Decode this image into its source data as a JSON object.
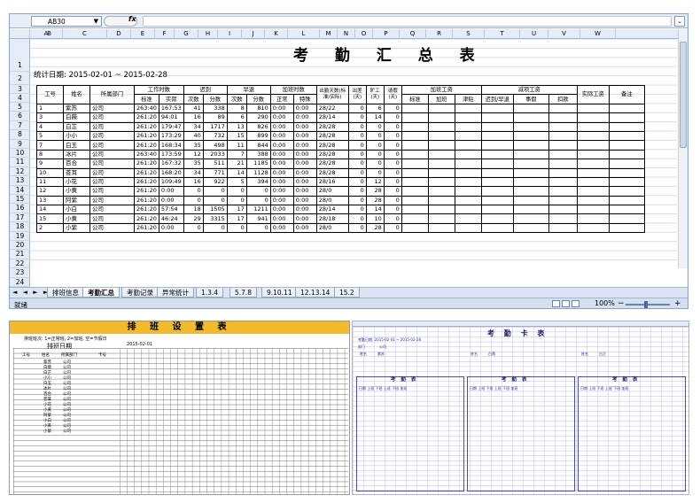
{
  "namebox": {
    "value": "AB30",
    "fx": "fx"
  },
  "columns": [
    "A",
    "B",
    "C",
    "D",
    "E",
    "F",
    "G",
    "H",
    "I",
    "J",
    "K",
    "L",
    "M",
    "N",
    "O",
    "P",
    "Q",
    "R",
    "S",
    "T",
    "U",
    "V",
    "W"
  ],
  "rows": [
    "1",
    "2",
    "3",
    "4",
    "5",
    "6",
    "7",
    "8",
    "9",
    "10",
    "11",
    "12",
    "13",
    "14",
    "15",
    "16",
    "17",
    "18",
    "19",
    "20",
    "21",
    "22",
    "23",
    "24"
  ],
  "sheet": {
    "title": "考 勤 汇 总 表",
    "date_range": "统计日期: 2015-02-01 ~ 2015-02-28",
    "header_top": {
      "emp_id": "工号",
      "name": "姓名",
      "dept": "所属部门",
      "work_hours": "工作时数",
      "late": "迟到",
      "early": "早退",
      "overtime_hours": "加班时数",
      "attend_days": "出勤天数(标准/实际)",
      "attend": "出差(天)",
      "absent": "旷工(天)",
      "leave": "请假(天)",
      "ot_pay": "加班工资",
      "deduct": "减项工资",
      "actual_pay": "实际工资",
      "remark": "备注"
    },
    "header_sub": {
      "standard": "标准",
      "actual": "实际",
      "times1": "次数",
      "minutes1": "分数",
      "times2": "次数",
      "minutes2": "分数",
      "normal": "正常",
      "special": "特殊",
      "std": "标准",
      "ot": "加班",
      "subsidy": "津贴",
      "late_early": "迟到/早退",
      "personal": "事假",
      "deduction": "扣款"
    },
    "records": [
      [
        "1",
        "紫苏",
        "公司",
        "263:40",
        "167:53",
        "41",
        "338",
        "8",
        "810",
        "0:00",
        "0:00",
        "28/22",
        "0",
        "6",
        "0"
      ],
      [
        "3",
        "白薇",
        "公司",
        "261:20",
        "94:01",
        "16",
        "89",
        "6",
        "290",
        "0:00",
        "0:00",
        "28/14",
        "0",
        "14",
        "0"
      ],
      [
        "4",
        "白芷",
        "公司",
        "261:20",
        "179:47",
        "34",
        "1717",
        "13",
        "826",
        "0:00",
        "0:00",
        "28/28",
        "0",
        "0",
        "0"
      ],
      [
        "5",
        "小小",
        "公司",
        "261:20",
        "173:29",
        "40",
        "732",
        "15",
        "899",
        "0:00",
        "0:00",
        "28/28",
        "0",
        "0",
        "0"
      ],
      [
        "7",
        "白玉",
        "公司",
        "261:20",
        "168:34",
        "35",
        "498",
        "11",
        "844",
        "0:00",
        "0:00",
        "28/28",
        "0",
        "0",
        "0"
      ],
      [
        "8",
        "冰片",
        "公司",
        "263:40",
        "173:59",
        "12",
        "2033",
        "7",
        "388",
        "0:00",
        "0:00",
        "28/28",
        "0",
        "0",
        "0"
      ],
      [
        "9",
        "百合",
        "公司",
        "261:20",
        "167:32",
        "35",
        "511",
        "21",
        "1185",
        "0:00",
        "0:00",
        "28/28",
        "0",
        "0",
        "0"
      ],
      [
        "10",
        "苍耳",
        "公司",
        "261:20",
        "168:20",
        "34",
        "771",
        "14",
        "1128",
        "0:00",
        "0:00",
        "28/28",
        "0",
        "0",
        "0"
      ],
      [
        "11",
        "小花",
        "公司",
        "261:20",
        "109:49",
        "16",
        "922",
        "5",
        "394",
        "0:00",
        "0:00",
        "28/16",
        "0",
        "12",
        "0"
      ],
      [
        "12",
        "小黄",
        "公司",
        "261:20",
        "0:00",
        "0",
        "0",
        "0",
        "0",
        "0:00",
        "0:00",
        "28/0",
        "0",
        "28",
        "0"
      ],
      [
        "13",
        "阿紫",
        "公司",
        "261:20",
        "0:00",
        "0",
        "0",
        "0",
        "0",
        "0:00",
        "0:00",
        "28/0",
        "0",
        "28",
        "0"
      ],
      [
        "14",
        "小白",
        "公司",
        "261:20",
        "57:54",
        "18",
        "1505",
        "17",
        "1211",
        "0:00",
        "0:00",
        "28/14",
        "0",
        "14",
        "0"
      ],
      [
        "15",
        "小黄",
        "公司",
        "261:20",
        "46:24",
        "29",
        "3315",
        "17",
        "941",
        "0:00",
        "0:00",
        "28/18",
        "0",
        "10",
        "0"
      ],
      [
        "2",
        "小紫",
        "公司",
        "261:20",
        "0:00",
        "0",
        "0",
        "0",
        "0",
        "0:00",
        "0:00",
        "28/0",
        "0",
        "28",
        "0"
      ]
    ]
  },
  "tabs": {
    "nav": "◄ ◄ ► ►",
    "items": [
      "排班信息",
      "考勤汇总",
      "考勤记录",
      "异常统计",
      "1.3.4",
      "5.7.8",
      "9.10.11",
      "12.13.14",
      "15.2"
    ],
    "active": "考勤汇总"
  },
  "status": {
    "ready": "就绪",
    "zoom": "100%",
    "minus": "−",
    "plus": "+"
  },
  "schedule": {
    "title": "排 班 设 置 表",
    "note": "排班班次: 1=正常班, 2=加班, 空=节假日",
    "date_label": "排班日期",
    "start_date": "2015-02-01",
    "col_emp": "工号",
    "col_name": "姓名",
    "col_dept": "所属部门",
    "col_card": "卡号",
    "names": [
      "紫苏",
      "白薇",
      "白芷",
      "小小",
      "白玉",
      "冰片",
      "百合",
      "苍耳",
      "小花",
      "小黄",
      "阿紫",
      "小白",
      "小黄",
      "小紫"
    ]
  },
  "card": {
    "title": "考 勤 卡 表",
    "panel_title": "考 勤 表",
    "date_range": "考勤日期: 2015-02-01 ~ 2015-02-28",
    "name_label": "姓名",
    "names": [
      "紫苏",
      "白薇",
      "白芷"
    ],
    "dept_label": "部门",
    "dept": "公司",
    "columns": "日期 上班 下班 上班 下班 加班"
  }
}
